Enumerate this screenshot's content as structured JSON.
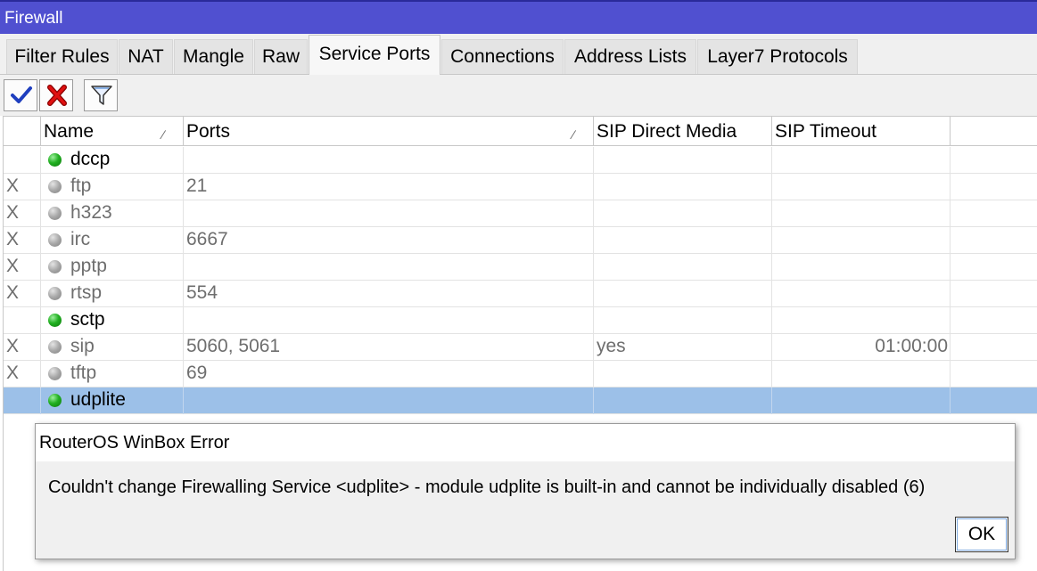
{
  "window": {
    "title": "Firewall"
  },
  "tabs": [
    {
      "label": "Filter Rules",
      "active": false
    },
    {
      "label": "NAT",
      "active": false
    },
    {
      "label": "Mangle",
      "active": false
    },
    {
      "label": "Raw",
      "active": false
    },
    {
      "label": "Service Ports",
      "active": true
    },
    {
      "label": "Connections",
      "active": false
    },
    {
      "label": "Address Lists",
      "active": false
    },
    {
      "label": "Layer7 Protocols",
      "active": false
    }
  ],
  "toolbar": {
    "enable_icon": "checkmark-icon",
    "disable_icon": "x-icon",
    "filter_icon": "filter-funnel-icon"
  },
  "table": {
    "columns": [
      "Name",
      "Ports",
      "SIP Direct Media",
      "SIP Timeout"
    ],
    "rows": [
      {
        "flag": "",
        "status": "enabled",
        "name": "dccp",
        "ports": "",
        "sip_direct_media": "",
        "sip_timeout": ""
      },
      {
        "flag": "X",
        "status": "disabled",
        "name": "ftp",
        "ports": "21",
        "sip_direct_media": "",
        "sip_timeout": ""
      },
      {
        "flag": "X",
        "status": "disabled",
        "name": "h323",
        "ports": "",
        "sip_direct_media": "",
        "sip_timeout": ""
      },
      {
        "flag": "X",
        "status": "disabled",
        "name": "irc",
        "ports": "6667",
        "sip_direct_media": "",
        "sip_timeout": ""
      },
      {
        "flag": "X",
        "status": "disabled",
        "name": "pptp",
        "ports": "",
        "sip_direct_media": "",
        "sip_timeout": ""
      },
      {
        "flag": "X",
        "status": "disabled",
        "name": "rtsp",
        "ports": "554",
        "sip_direct_media": "",
        "sip_timeout": ""
      },
      {
        "flag": "",
        "status": "enabled",
        "name": "sctp",
        "ports": "",
        "sip_direct_media": "",
        "sip_timeout": ""
      },
      {
        "flag": "X",
        "status": "disabled",
        "name": "sip",
        "ports": "5060, 5061",
        "sip_direct_media": "yes",
        "sip_timeout": "01:00:00"
      },
      {
        "flag": "X",
        "status": "disabled",
        "name": "tftp",
        "ports": "69",
        "sip_direct_media": "",
        "sip_timeout": ""
      },
      {
        "flag": "",
        "status": "enabled",
        "name": "udplite",
        "ports": "",
        "sip_direct_media": "",
        "sip_timeout": "",
        "selected": true
      }
    ]
  },
  "dialog": {
    "title": "RouterOS WinBox Error",
    "message": "Couldn't change Firewalling Service <udplite> - module udplite is built-in and cannot be individually disabled (6)",
    "ok_label": "OK"
  },
  "colors": {
    "titlebar": "#5050d0",
    "selected_row": "#9cc0e8",
    "enabled_dot": "#22b022",
    "disabled_dot": "#a8a8a8",
    "check_blue": "#1f3fbf",
    "x_red": "#e01010"
  }
}
